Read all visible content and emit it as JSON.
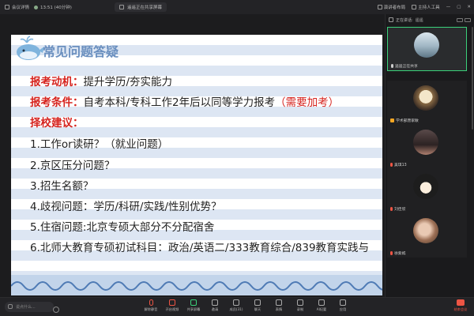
{
  "topbar": {
    "app_title": "会议详情",
    "status": "13:51 (40分钟)",
    "share_banner": "遥遥正在共享屏幕",
    "speaker_view": "演讲者布局",
    "host_tools": "主持人工具"
  },
  "slide": {
    "heading": "常见问题答疑",
    "motive_label": "报考动机：",
    "motive_text": "提升学历/夯实能力",
    "condition_label": "报考条件：",
    "condition_text": "自考本科/专科工作2年后以同等学力报考",
    "condition_note": "（需要加考）",
    "advice_label": "择校建议：",
    "items": [
      "1.工作or读研？（就业问题）",
      "2.京区压分问题？",
      "3.招生名额？",
      "4.歧视问题：学历/科研/实践/性别优势？",
      "5.住宿问题:北京专硕大部分不分配宿舍",
      "6.北师大教育专硕初试科目：政治/英语二/333教育综合/839教育实践与"
    ]
  },
  "sidebar": {
    "speaking_label": "正在讲话:",
    "speaking_name": "遥遥",
    "participants": [
      {
        "name": "遥遥正在共享",
        "active": true,
        "muted": false
      },
      {
        "name": "学术部唐家敏",
        "active": false,
        "muted": false
      },
      {
        "name": "吴琪13",
        "active": false,
        "muted": true
      },
      {
        "name": "刘佳欣",
        "active": false,
        "muted": true
      },
      {
        "name": "徐紫嫣",
        "active": false,
        "muted": true
      }
    ]
  },
  "bottombar": {
    "chat_placeholder": "说点什么...",
    "tools": [
      {
        "label": "解除静音",
        "icon": "mic-off-icon"
      },
      {
        "label": "开启视频",
        "icon": "video-off-icon"
      },
      {
        "label": "共享屏幕",
        "icon": "screen-share-icon"
      },
      {
        "label": "邀请",
        "icon": "invite-icon"
      },
      {
        "label": "成员(31)",
        "icon": "members-icon"
      },
      {
        "label": "聊天",
        "icon": "chat-icon"
      },
      {
        "label": "表情",
        "icon": "emoji-icon"
      },
      {
        "label": "录制",
        "icon": "record-icon"
      },
      {
        "label": "AI纪要",
        "icon": "ai-notes-icon"
      },
      {
        "label": "应用",
        "icon": "apps-icon"
      }
    ],
    "leave_label": "结束会议"
  },
  "colors": {
    "accent_red": "#d6241f",
    "heading_blue": "#6a8fbf",
    "active_green": "#3bd17a"
  }
}
